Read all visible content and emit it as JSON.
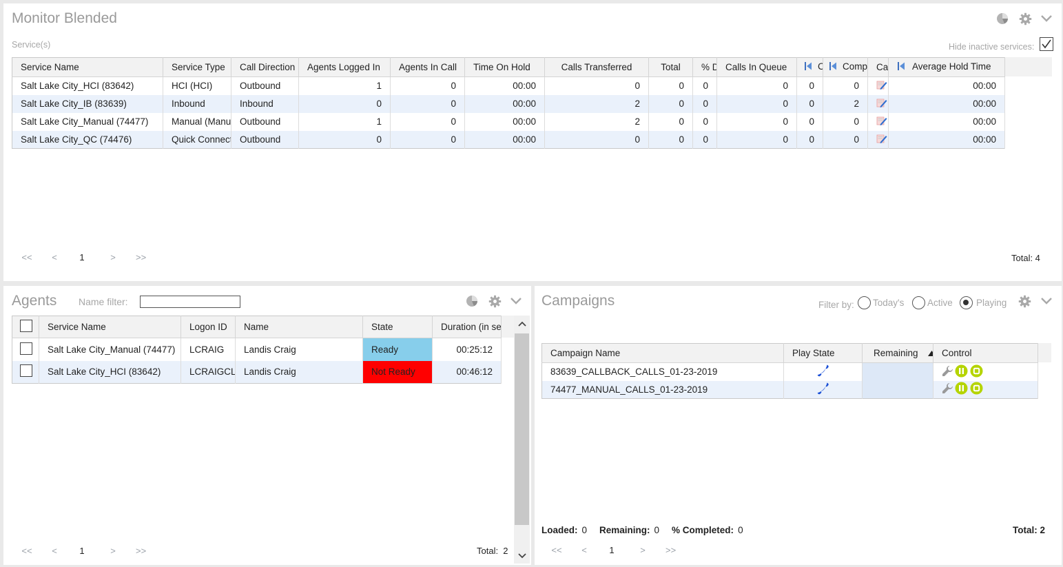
{
  "monitor": {
    "title": "Monitor Blended",
    "services_label": "Service(s)",
    "hide_inactive_label": "Hide inactive services:",
    "hide_inactive_checked": true,
    "columns": [
      "Service Name",
      "Service Type",
      "Call Direction",
      "Agents Logged In",
      "Agents In Call",
      "Time On Hold",
      "Calls Transferred",
      "Total",
      "% D",
      "Calls In Queue",
      "C",
      "Comp",
      "Ca",
      "Average Hold Time"
    ],
    "rows": [
      [
        "Salt Lake City_HCI (83642)",
        "HCI (HCI)",
        "Outbound",
        "1",
        "0",
        "00:00",
        "0",
        "0",
        "0",
        "0",
        "0",
        "0",
        "",
        "00:00"
      ],
      [
        "Salt Lake City_IB (83639)",
        "Inbound",
        "Inbound",
        "0",
        "0",
        "00:00",
        "2",
        "0",
        "0",
        "0",
        "0",
        "2",
        "",
        "00:00"
      ],
      [
        "Salt Lake City_Manual (74477)",
        "Manual (Manual)",
        "Outbound",
        "1",
        "0",
        "00:00",
        "2",
        "0",
        "0",
        "0",
        "0",
        "0",
        "",
        "00:00"
      ],
      [
        "Salt Lake City_QC (74476)",
        "Quick Connect",
        "Outbound",
        "0",
        "0",
        "00:00",
        "0",
        "0",
        "0",
        "0",
        "0",
        "0",
        "",
        "00:00"
      ]
    ],
    "pager": {
      "first": "<<",
      "prev": "<",
      "page": "1",
      "next": ">",
      "last": ">>"
    },
    "total": "Total: 4"
  },
  "agents": {
    "title": "Agents",
    "name_filter_label": "Name filter:",
    "name_filter_value": "",
    "columns": [
      "",
      "Service Name",
      "Logon ID",
      "Name",
      "State",
      "Duration (in sec)"
    ],
    "rows": [
      {
        "service": "Salt Lake City_Manual (74477)",
        "logon": "LCRAIG",
        "name": "Landis Craig",
        "state": "Ready",
        "state_color": "#87ceeb",
        "duration": "00:25:12"
      },
      {
        "service": "Salt Lake City_HCI (83642)",
        "logon": "LCRAIGCLI",
        "name": "Landis Craig",
        "state": "Not Ready",
        "state_color": "#ff0000",
        "duration": "00:46:12"
      }
    ],
    "pager": {
      "first": "<<",
      "prev": "<",
      "page": "1",
      "next": ">",
      "last": ">>"
    },
    "total": "Total:  2"
  },
  "campaigns": {
    "title": "Campaigns",
    "filter_label": "Filter by:",
    "filters": [
      "Today's",
      "Active",
      "Playing"
    ],
    "filter_selected": "Playing",
    "columns": [
      "Campaign Name",
      "Play State",
      "Remaining",
      "Control"
    ],
    "rows": [
      {
        "name": "83639_CALLBACK_CALLS_01-23-2019",
        "remaining": ""
      },
      {
        "name": "74477_MANUAL_CALLS_01-23-2019",
        "remaining": ""
      }
    ],
    "summary": {
      "loaded_label": "Loaded:",
      "loaded": "0",
      "remaining_label": "Remaining:",
      "remaining": "0",
      "completed_label": "% Completed:",
      "completed": "0"
    },
    "total": "Total: 2",
    "pager": {
      "first": "<<",
      "prev": "<",
      "page": "1",
      "next": ">",
      "last": ">>"
    }
  },
  "colors": {
    "accent_green": "#b5d400",
    "phone_blue": "#1a4fd6",
    "ready": "#87ceeb",
    "not_ready": "#ff0000",
    "row_alt": "#eaf1fb"
  },
  "icons": [
    "pie-chart-icon",
    "gear-icon",
    "chevron-down-icon",
    "expand-left-icon",
    "edit-icon",
    "phone-icon",
    "wrench-icon",
    "pause-icon",
    "stop-icon",
    "sort-asc-icon"
  ]
}
